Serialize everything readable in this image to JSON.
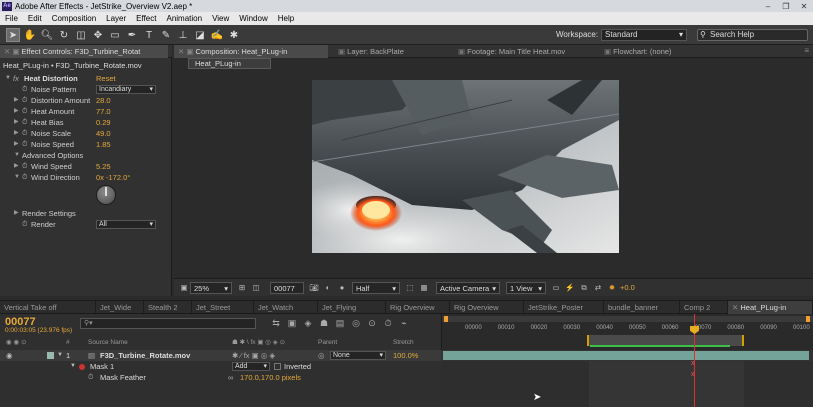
{
  "app": {
    "title": "Adobe After Effects - JetStrike_Overview V2.aep *",
    "logo": "Ae"
  },
  "window_controls": {
    "minimize": "–",
    "maximize": "❐",
    "close": "✕"
  },
  "menu": [
    "File",
    "Edit",
    "Composition",
    "Layer",
    "Effect",
    "Animation",
    "View",
    "Window",
    "Help"
  ],
  "toolbar": {
    "workspace_label": "Workspace:",
    "workspace_value": "Standard",
    "search_placeholder": "Search Help"
  },
  "effect_controls": {
    "tab_label": "Effect Controls: F3D_Turbine_Rotat",
    "path": "Heat_PLug-in • F3D_Turbine_Rotate.mov",
    "effect_name": "Heat Distortion",
    "reset": "Reset",
    "params": [
      {
        "label": "Noise Pattern",
        "value": "Incandiary"
      },
      {
        "label": "Distortion Amount",
        "value": "28.0"
      },
      {
        "label": "Heat Amount",
        "value": "77.0"
      },
      {
        "label": "Heat Bias",
        "value": "0.29"
      },
      {
        "label": "Noise Scale",
        "value": "49.0"
      },
      {
        "label": "Noise Speed",
        "value": "1.85"
      }
    ],
    "advanced_label": "Advanced Options",
    "wind_speed": {
      "label": "Wind Speed",
      "value": "5.25"
    },
    "wind_direction": {
      "label": "Wind Direction",
      "value": "0x -172.0°"
    },
    "render_settings_label": "Render Settings",
    "render": {
      "label": "Render",
      "value": "All"
    }
  },
  "comp_panel": {
    "tabs": [
      {
        "label": "Composition: Heat_PLug-in"
      },
      {
        "label": "Layer: BackPlate"
      },
      {
        "label": "Footage: Main Title Heat.mov"
      },
      {
        "label": "Flowchart: (none)"
      }
    ],
    "sub_tab": "Heat_PLug-in",
    "footer": {
      "zoom": "25%",
      "timecode": "00077",
      "resolution": "Half",
      "camera": "Active Camera",
      "views": "1 View",
      "exposure": "+0.0"
    }
  },
  "timeline_tabs": [
    "Vertical Take off",
    "Jet_Wide",
    "Stealth 2",
    "Jet_Street",
    "Jet_Watch",
    "Jet_Flying",
    "Rig Overview",
    "Rig Overview",
    "JetStrike_Poster",
    "bundle_banner",
    "Comp 2",
    "Heat_PLug-in"
  ],
  "timeline": {
    "timecode": "00077",
    "timecode_sub": "0:00:03:05 (23.976 fps)",
    "columns": {
      "num": "#",
      "source_name": "Source Name",
      "parent": "Parent",
      "stretch": "Stretch"
    },
    "layer": {
      "index": "1",
      "name": "F3D_Turbine_Rotate.mov",
      "parent": "None",
      "stretch": "100.0%"
    },
    "mask": {
      "name": "Mask 1",
      "mode": "Add",
      "inverted_label": "Inverted"
    },
    "mask_feather": {
      "label": "Mask Feather",
      "value": "170.0,170.0 pixels"
    },
    "ruler_ticks": [
      "00000",
      "00010",
      "00020",
      "00030",
      "00040",
      "00050",
      "00060",
      "00070",
      "00080",
      "00090",
      "00100",
      "0011"
    ]
  }
}
